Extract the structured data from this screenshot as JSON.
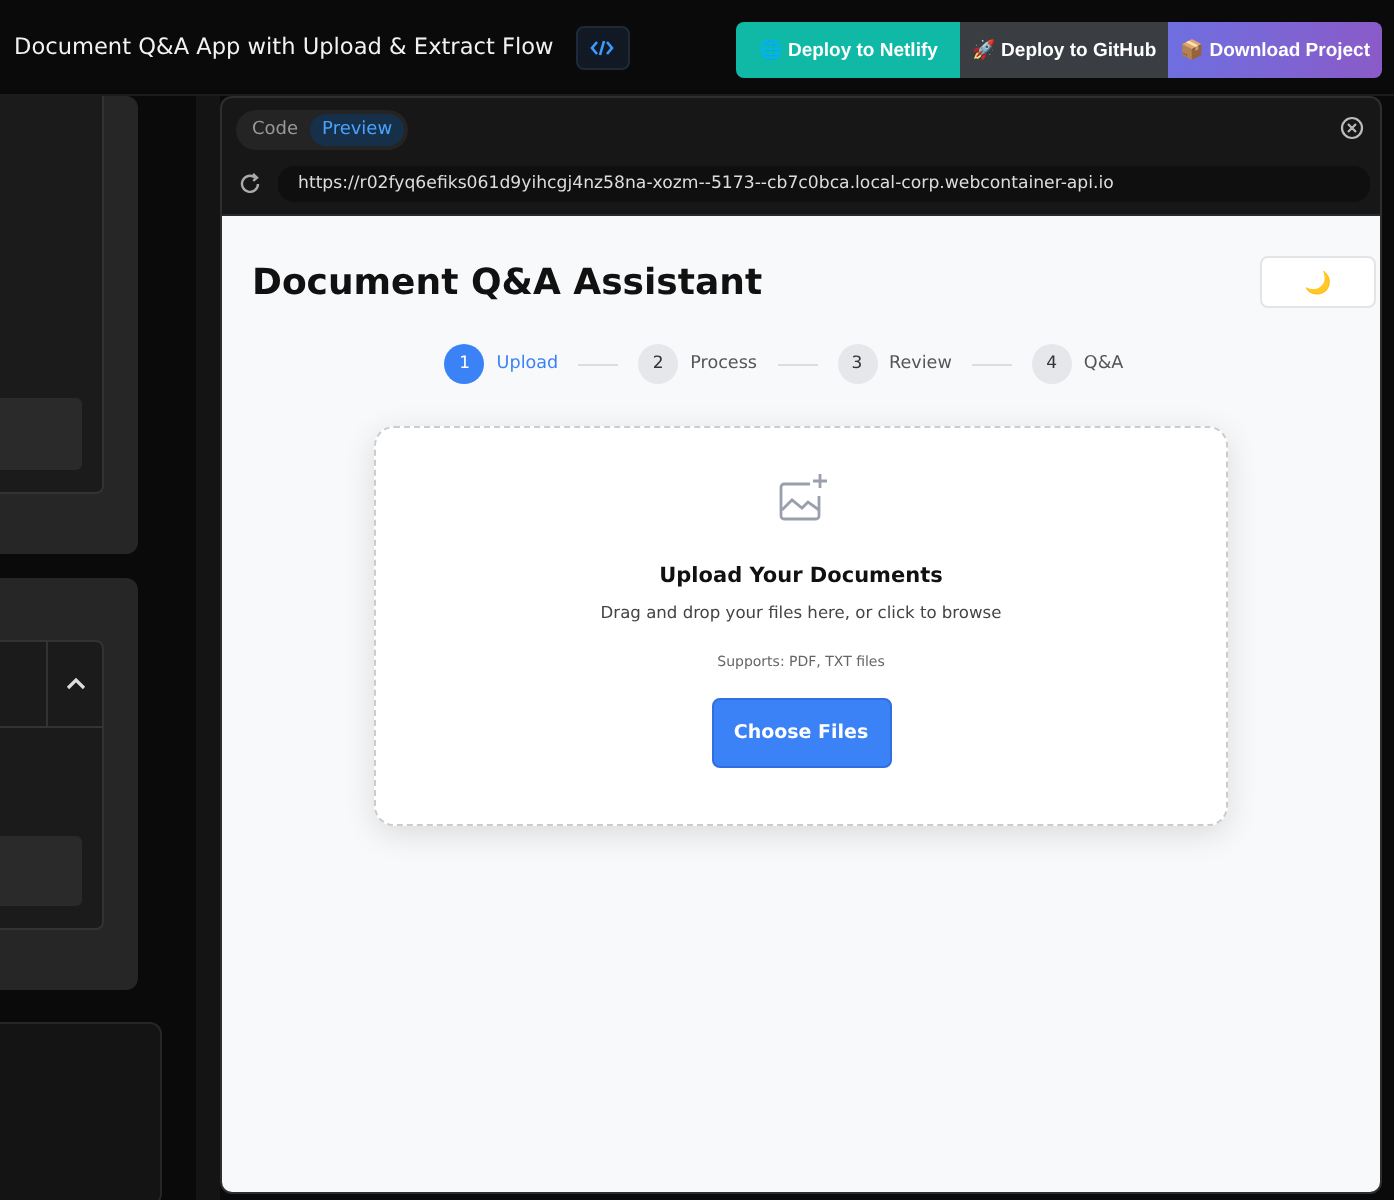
{
  "header": {
    "title": "Document Q&A App with Upload & Extract Flow"
  },
  "deploy_buttons": [
    {
      "label": "🌐 Deploy to Netlify",
      "kind": "netlify"
    },
    {
      "label": "🚀 Deploy to GitHub",
      "kind": "github"
    },
    {
      "label": "📦 Download Project",
      "kind": "download"
    }
  ],
  "preview": {
    "tabs": [
      {
        "label": "Code",
        "selected": false
      },
      {
        "label": "Preview",
        "selected": true
      }
    ],
    "url": "https://r02fyq6efiks061d9yihcgj4nz58na-xozm--5173--cb7c0bca.local-corp.webcontainer-api.io"
  },
  "app": {
    "title": "Document Q&A Assistant",
    "theme_toggle": "🌙",
    "steps": [
      {
        "number": "1",
        "label": "Upload",
        "selected": true
      },
      {
        "number": "2",
        "label": "Process",
        "selected": false
      },
      {
        "number": "3",
        "label": "Review",
        "selected": false
      },
      {
        "number": "4",
        "label": "Q&A",
        "selected": false
      }
    ],
    "dropzone": {
      "heading": "Upload Your Documents",
      "instructions": "Drag and drop your files here, or click to browse",
      "supports": "Supports: PDF, TXT files",
      "button": "Choose Files"
    }
  }
}
